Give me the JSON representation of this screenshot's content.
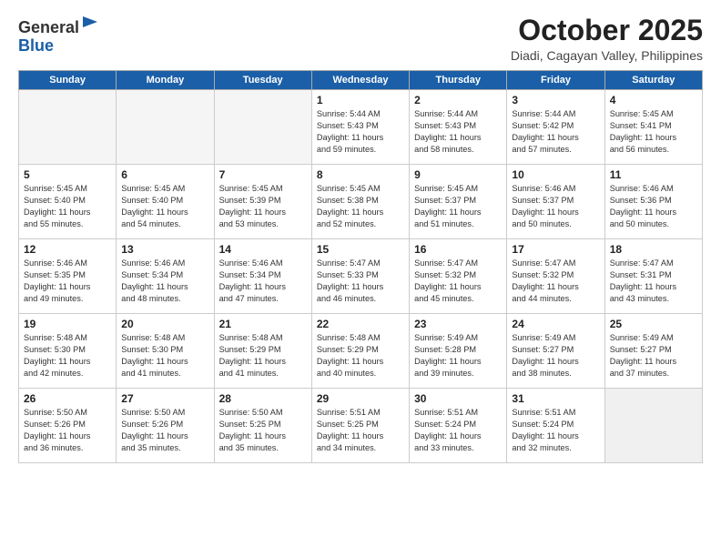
{
  "header": {
    "logo_general": "General",
    "logo_blue": "Blue",
    "month_title": "October 2025",
    "location": "Diadi, Cagayan Valley, Philippines"
  },
  "weekdays": [
    "Sunday",
    "Monday",
    "Tuesday",
    "Wednesday",
    "Thursday",
    "Friday",
    "Saturday"
  ],
  "weeks": [
    [
      {
        "day": null,
        "info": null
      },
      {
        "day": null,
        "info": null
      },
      {
        "day": null,
        "info": null
      },
      {
        "day": "1",
        "info": "Sunrise: 5:44 AM\nSunset: 5:43 PM\nDaylight: 11 hours\nand 59 minutes."
      },
      {
        "day": "2",
        "info": "Sunrise: 5:44 AM\nSunset: 5:43 PM\nDaylight: 11 hours\nand 58 minutes."
      },
      {
        "day": "3",
        "info": "Sunrise: 5:44 AM\nSunset: 5:42 PM\nDaylight: 11 hours\nand 57 minutes."
      },
      {
        "day": "4",
        "info": "Sunrise: 5:45 AM\nSunset: 5:41 PM\nDaylight: 11 hours\nand 56 minutes."
      }
    ],
    [
      {
        "day": "5",
        "info": "Sunrise: 5:45 AM\nSunset: 5:40 PM\nDaylight: 11 hours\nand 55 minutes."
      },
      {
        "day": "6",
        "info": "Sunrise: 5:45 AM\nSunset: 5:40 PM\nDaylight: 11 hours\nand 54 minutes."
      },
      {
        "day": "7",
        "info": "Sunrise: 5:45 AM\nSunset: 5:39 PM\nDaylight: 11 hours\nand 53 minutes."
      },
      {
        "day": "8",
        "info": "Sunrise: 5:45 AM\nSunset: 5:38 PM\nDaylight: 11 hours\nand 52 minutes."
      },
      {
        "day": "9",
        "info": "Sunrise: 5:45 AM\nSunset: 5:37 PM\nDaylight: 11 hours\nand 51 minutes."
      },
      {
        "day": "10",
        "info": "Sunrise: 5:46 AM\nSunset: 5:37 PM\nDaylight: 11 hours\nand 50 minutes."
      },
      {
        "day": "11",
        "info": "Sunrise: 5:46 AM\nSunset: 5:36 PM\nDaylight: 11 hours\nand 50 minutes."
      }
    ],
    [
      {
        "day": "12",
        "info": "Sunrise: 5:46 AM\nSunset: 5:35 PM\nDaylight: 11 hours\nand 49 minutes."
      },
      {
        "day": "13",
        "info": "Sunrise: 5:46 AM\nSunset: 5:34 PM\nDaylight: 11 hours\nand 48 minutes."
      },
      {
        "day": "14",
        "info": "Sunrise: 5:46 AM\nSunset: 5:34 PM\nDaylight: 11 hours\nand 47 minutes."
      },
      {
        "day": "15",
        "info": "Sunrise: 5:47 AM\nSunset: 5:33 PM\nDaylight: 11 hours\nand 46 minutes."
      },
      {
        "day": "16",
        "info": "Sunrise: 5:47 AM\nSunset: 5:32 PM\nDaylight: 11 hours\nand 45 minutes."
      },
      {
        "day": "17",
        "info": "Sunrise: 5:47 AM\nSunset: 5:32 PM\nDaylight: 11 hours\nand 44 minutes."
      },
      {
        "day": "18",
        "info": "Sunrise: 5:47 AM\nSunset: 5:31 PM\nDaylight: 11 hours\nand 43 minutes."
      }
    ],
    [
      {
        "day": "19",
        "info": "Sunrise: 5:48 AM\nSunset: 5:30 PM\nDaylight: 11 hours\nand 42 minutes."
      },
      {
        "day": "20",
        "info": "Sunrise: 5:48 AM\nSunset: 5:30 PM\nDaylight: 11 hours\nand 41 minutes."
      },
      {
        "day": "21",
        "info": "Sunrise: 5:48 AM\nSunset: 5:29 PM\nDaylight: 11 hours\nand 41 minutes."
      },
      {
        "day": "22",
        "info": "Sunrise: 5:48 AM\nSunset: 5:29 PM\nDaylight: 11 hours\nand 40 minutes."
      },
      {
        "day": "23",
        "info": "Sunrise: 5:49 AM\nSunset: 5:28 PM\nDaylight: 11 hours\nand 39 minutes."
      },
      {
        "day": "24",
        "info": "Sunrise: 5:49 AM\nSunset: 5:27 PM\nDaylight: 11 hours\nand 38 minutes."
      },
      {
        "day": "25",
        "info": "Sunrise: 5:49 AM\nSunset: 5:27 PM\nDaylight: 11 hours\nand 37 minutes."
      }
    ],
    [
      {
        "day": "26",
        "info": "Sunrise: 5:50 AM\nSunset: 5:26 PM\nDaylight: 11 hours\nand 36 minutes."
      },
      {
        "day": "27",
        "info": "Sunrise: 5:50 AM\nSunset: 5:26 PM\nDaylight: 11 hours\nand 35 minutes."
      },
      {
        "day": "28",
        "info": "Sunrise: 5:50 AM\nSunset: 5:25 PM\nDaylight: 11 hours\nand 35 minutes."
      },
      {
        "day": "29",
        "info": "Sunrise: 5:51 AM\nSunset: 5:25 PM\nDaylight: 11 hours\nand 34 minutes."
      },
      {
        "day": "30",
        "info": "Sunrise: 5:51 AM\nSunset: 5:24 PM\nDaylight: 11 hours\nand 33 minutes."
      },
      {
        "day": "31",
        "info": "Sunrise: 5:51 AM\nSunset: 5:24 PM\nDaylight: 11 hours\nand 32 minutes."
      },
      {
        "day": null,
        "info": null
      }
    ]
  ]
}
